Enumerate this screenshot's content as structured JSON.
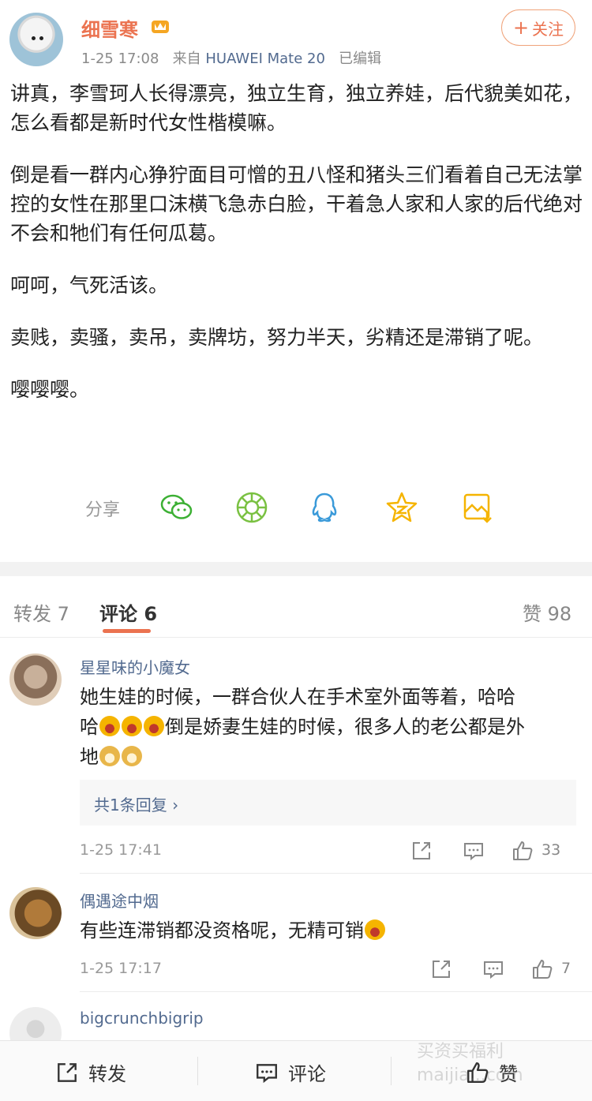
{
  "post": {
    "username": "细雪寒",
    "meta": {
      "time": "1-25 17:08",
      "source_prefix": "来自",
      "device": "HUAWEI Mate 20",
      "edited": "已编辑"
    },
    "follow_label": "关注",
    "paragraphs": [
      "讲真，李雪珂人长得漂亮，独立生育，独立养娃，后代貌美如花，怎么看都是新时代女性楷模嘛。",
      "倒是看一群内心狰狞面目可憎的丑八怪和猪头三们看着自己无法掌控的女性在那里口沫横飞急赤白脸，干着急人家和人家的后代绝对不会和牠们有任何瓜葛。",
      "呵呵，气死活该。",
      "卖贱，卖骚，卖吊，卖牌坊，努力半天，劣精还是滞销了呢。",
      "嘤嘤嘤。"
    ],
    "share_label": "分享",
    "share_icons": [
      "wechat-icon",
      "moments-icon",
      "qq-icon",
      "qzone-icon",
      "save-image-icon"
    ]
  },
  "tabs": {
    "repost": "转发 7",
    "comments": "评论 6",
    "likes": "赞 98"
  },
  "comments": [
    {
      "name": "星星味的小魔女",
      "text_line1": "她生娃的时候，一群合伙人在手术室外面等着，哈哈",
      "text_line2_prefix": "哈",
      "text_line2_suffix": "倒是娇妻生娃的时候，很多人的老公都是外",
      "text_line3": "地",
      "reply": "共1条回复 ›",
      "time": "1-25 17:41",
      "likes": "33"
    },
    {
      "name": "偶遇途中烟",
      "text": "有些连滞销都没资格呢，无精可销",
      "time": "1-25 17:17",
      "likes": "7"
    },
    {
      "name": "bigcrunchbigrip"
    }
  ],
  "bottom_bar": {
    "repost": "转发",
    "comment": "评论",
    "like": "赞"
  },
  "watermark": "买资买福利\nmaijia...com",
  "colors": {
    "accent": "#eb7350",
    "link": "#526a8f",
    "wechat": "#3cb034",
    "moments": "#7ac142",
    "qq": "#3a9ad9",
    "qzone": "#f5b400"
  }
}
